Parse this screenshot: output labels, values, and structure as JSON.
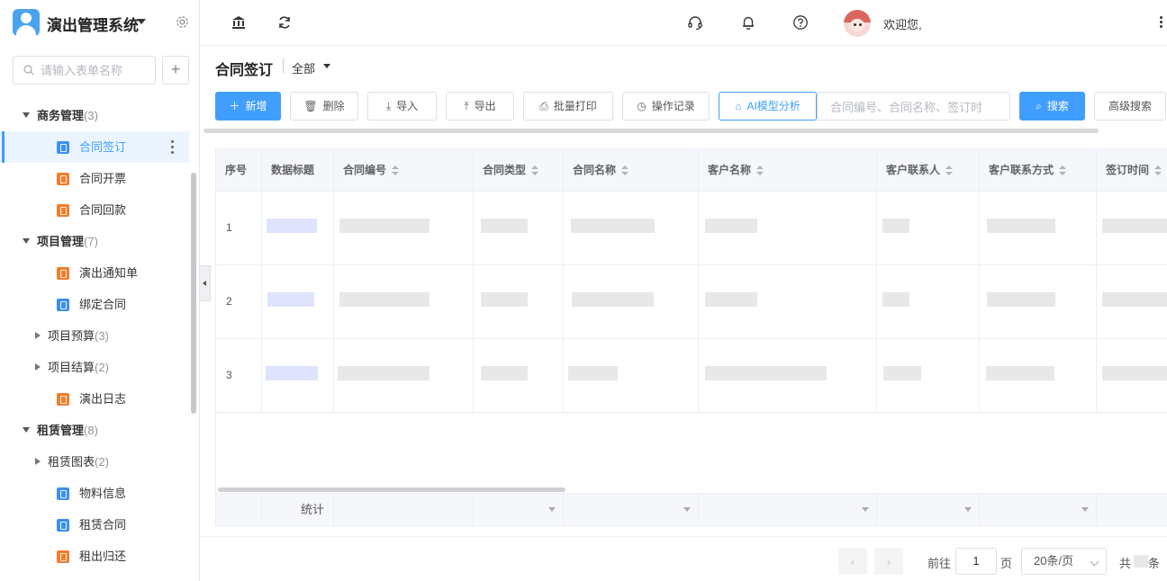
{
  "app": {
    "title": "演出管理系统"
  },
  "sidebar": {
    "search_placeholder": "请输入表单名称",
    "add_label": "+",
    "groups": [
      {
        "label": "商务管理",
        "count": "(3)",
        "items": [
          "合同签订",
          "合同开票",
          "合同回款"
        ]
      },
      {
        "label": "项目管理",
        "count": "(7)",
        "items": [
          "演出通知单",
          "绑定合同"
        ],
        "subgroups": [
          {
            "label": "项目预算",
            "count": "(3)"
          },
          {
            "label": "项目结算",
            "count": "(2)"
          }
        ],
        "after": [
          "演出日志"
        ]
      },
      {
        "label": "租赁管理",
        "count": "(8)",
        "subgroups": [
          {
            "label": "租赁图表",
            "count": "(2)"
          }
        ],
        "items": [
          "物料信息",
          "租赁合同",
          "租出归还"
        ]
      }
    ],
    "active_item": "合同签订"
  },
  "header": {
    "welcome": "欢迎您,"
  },
  "page": {
    "title": "合同签订",
    "filter": "全部"
  },
  "toolbar": {
    "add": "新增",
    "delete": "删除",
    "import": "导入",
    "export": "导出",
    "batch_print": "批量打印",
    "log": "操作记录",
    "ai": "AI模型分析",
    "search_placeholder": "合同编号、合同名称、签订时",
    "search": "搜索",
    "advanced": "高级搜索"
  },
  "table": {
    "columns": [
      "序号",
      "数据标题",
      "合同编号",
      "合同类型",
      "合同名称",
      "客户名称",
      "客户联系人",
      "客户联系方式",
      "签订时间"
    ],
    "rows": [
      "1",
      "2",
      "3"
    ],
    "summary_label": "统计"
  },
  "pagination": {
    "prev": "‹",
    "next": "›",
    "goto_label": "前往",
    "page_value": "1",
    "page_unit": "页",
    "page_size": "20条/页",
    "total_prefix": "共",
    "total_suffix": "条"
  },
  "colors": {
    "primary": "#409eff",
    "doc_blue": "#3d8ff5",
    "doc_orange": "#f57c2b"
  }
}
